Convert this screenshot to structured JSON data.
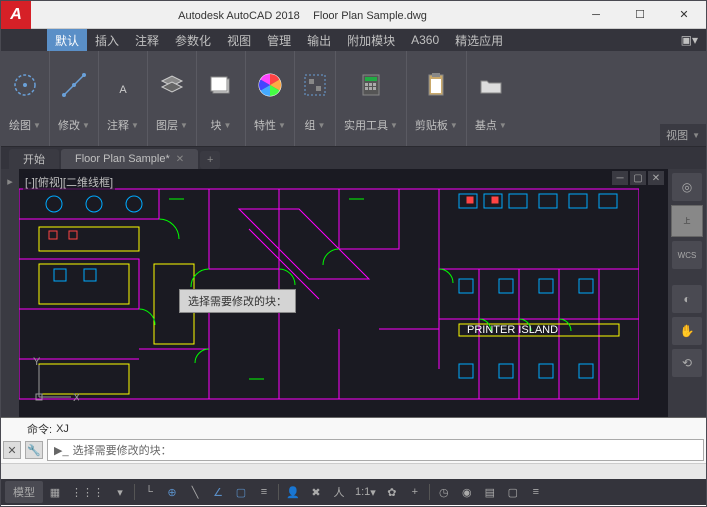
{
  "title": {
    "app": "Autodesk AutoCAD 2018",
    "file": "Floor Plan Sample.dwg"
  },
  "menu": {
    "items": [
      "默认",
      "插入",
      "注释",
      "参数化",
      "视图",
      "管理",
      "输出",
      "附加模块",
      "A360",
      "精选应用"
    ]
  },
  "ribbon": {
    "panels": [
      {
        "label": "绘图"
      },
      {
        "label": "修改"
      },
      {
        "label": "注释"
      },
      {
        "label": "图层"
      },
      {
        "label": "块"
      },
      {
        "label": "特性"
      },
      {
        "label": "组"
      },
      {
        "label": "实用工具"
      },
      {
        "label": "剪贴板"
      },
      {
        "label": "基点"
      }
    ],
    "corner": "视图"
  },
  "tabs": {
    "home": "开始",
    "active": "Floor Plan Sample*"
  },
  "canvas": {
    "viewLabel": "[-][俯视][二维线框]",
    "tooltip": "选择需要修改的块：",
    "wcs": "WCS",
    "printerLabel": "PRINTER ISLAND"
  },
  "command": {
    "historyPrefix": "命令:",
    "historyText": "XJ",
    "prompt": "选择需要修改的块："
  },
  "status": {
    "model": "模型",
    "scale": "1:1"
  }
}
